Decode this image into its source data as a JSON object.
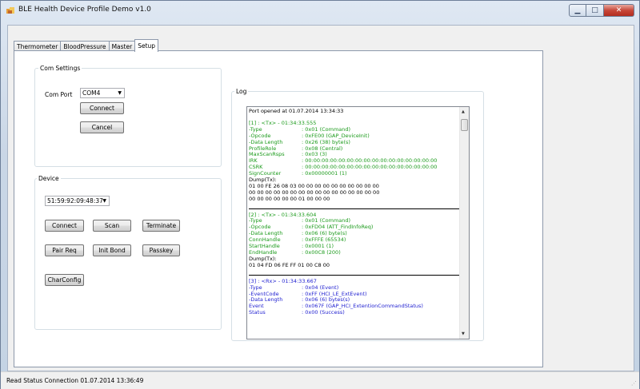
{
  "window": {
    "title": "BLE Health Device Profile Demo v1.0"
  },
  "tabs": [
    "Thermometer",
    "BloodPressure",
    "Master",
    "Setup"
  ],
  "com_settings": {
    "title": "Com Settings",
    "port_label": "Com Port",
    "port_value": "COM4",
    "connect": "Connect",
    "cancel": "Cancel"
  },
  "device": {
    "title": "Device",
    "address": "51:59:92:09:48:37",
    "connect": "Connect",
    "scan": "Scan",
    "terminate": "Terminate",
    "pair_req": "Pair Req",
    "init_bond": "Init Bond",
    "passkey": "Passkey",
    "char_config": "CharConfig"
  },
  "log": {
    "title": "Log",
    "opened": "Port opened at 01.07.2014 13:34:33",
    "e1": {
      "header": "[1] : <Tx> - 01:34:33.555",
      "rows": [
        [
          "-Type",
          ": 0x01 (Command)"
        ],
        [
          "-Opcode",
          ": 0xFE00 (GAP_DeviceInit)"
        ],
        [
          "-Data Length",
          ": 0x26 (38) byte(s)"
        ],
        [
          " ProfileRole",
          ": 0x08 (Central)"
        ],
        [
          " MaxScanRsps",
          ": 0x03 (3)"
        ],
        [
          " IRK",
          ": 00:00:00:00:00:00:00:00:00:00:00:00:00:00:00:00"
        ],
        [
          " CSRK",
          ": 00:00:00:00:00:00:00:00:00:00:00:00:00:00:00:00"
        ],
        [
          " SignCounter",
          ": 0x00000001 (1)"
        ]
      ],
      "dump_label": "Dump(Tx):",
      "dump": [
        "01 00 FE 26 08 03 00 00 00 00 00 00 00 00 00 00",
        "00 00 00 00 00 00 00 00 00 00 00 00 00 00 00 00",
        "00 00 00 00 00 00 01 00 00 00"
      ]
    },
    "e2": {
      "header": "[2] : <Tx> - 01:34:33.604",
      "rows": [
        [
          "-Type",
          ": 0x01 (Command)"
        ],
        [
          "-Opcode",
          ": 0xFD04 (ATT_FindInfoReq)"
        ],
        [
          "-Data Length",
          ": 0x06 (6) byte(s)"
        ],
        [
          " ConnHandle",
          ": 0xFFFE (65534)"
        ],
        [
          " StartHandle",
          ": 0x0001 (1)"
        ],
        [
          " EndHandle",
          ": 0x00C8 (200)"
        ]
      ],
      "dump_label": "Dump(Tx):",
      "dump": [
        "01 04 FD 06 FE FF 01 00 C8 00"
      ]
    },
    "e3": {
      "header": "[3] : <Rx> - 01:34:33.667",
      "rows": [
        [
          "-Type",
          ": 0x04 (Event)"
        ],
        [
          "-EventCode",
          ": 0xFF (HCI_LE_ExtEvent)"
        ],
        [
          "-Data Length",
          ": 0x06 (6) bytes(s)"
        ],
        [
          " Event",
          ": 0x067F (GAP_HCI_ExtentionCommandStatus)"
        ],
        [
          " Status",
          ": 0x00 (Success)"
        ]
      ]
    }
  },
  "status": {
    "text": "Read Status  Connection  01.07.2014 13:36:49"
  },
  "colors": {
    "tx": "#1a9a1a",
    "rx": "#1d1dd0"
  }
}
